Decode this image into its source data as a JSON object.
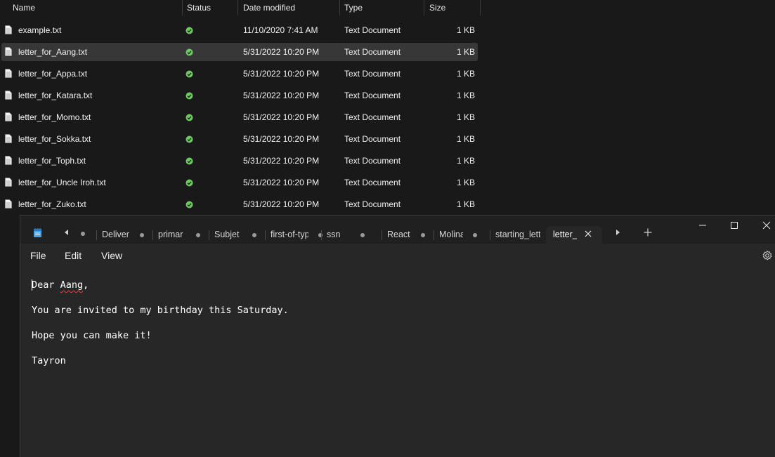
{
  "explorer": {
    "columns": {
      "name": "Name",
      "status": "Status",
      "date": "Date modified",
      "type": "Type",
      "size": "Size"
    },
    "files": [
      {
        "name": "example.txt",
        "date": "11/10/2020 7:41 AM",
        "type": "Text Document",
        "size": "1 KB",
        "selected": false
      },
      {
        "name": "letter_for_Aang.txt",
        "date": "5/31/2022 10:20 PM",
        "type": "Text Document",
        "size": "1 KB",
        "selected": true
      },
      {
        "name": "letter_for_Appa.txt",
        "date": "5/31/2022 10:20 PM",
        "type": "Text Document",
        "size": "1 KB",
        "selected": false
      },
      {
        "name": "letter_for_Katara.txt",
        "date": "5/31/2022 10:20 PM",
        "type": "Text Document",
        "size": "1 KB",
        "selected": false
      },
      {
        "name": "letter_for_Momo.txt",
        "date": "5/31/2022 10:20 PM",
        "type": "Text Document",
        "size": "1 KB",
        "selected": false
      },
      {
        "name": "letter_for_Sokka.txt",
        "date": "5/31/2022 10:20 PM",
        "type": "Text Document",
        "size": "1 KB",
        "selected": false
      },
      {
        "name": "letter_for_Toph.txt",
        "date": "5/31/2022 10:20 PM",
        "type": "Text Document",
        "size": "1 KB",
        "selected": false
      },
      {
        "name": "letter_for_Uncle Iroh.txt",
        "date": "5/31/2022 10:20 PM",
        "type": "Text Document",
        "size": "1 KB",
        "selected": false
      },
      {
        "name": "letter_for_Zuko.txt",
        "date": "5/31/2022 10:20 PM",
        "type": "Text Document",
        "size": "1 KB",
        "selected": false
      }
    ],
    "status_icon": "synced-check-icon",
    "status_color": "#6ccb5f"
  },
  "notepad": {
    "app_icon": "notepad-icon",
    "tabs": [
      {
        "label": "Deliver",
        "active": false
      },
      {
        "label": "primar",
        "active": false
      },
      {
        "label": "Subjet",
        "active": false
      },
      {
        "label": "first-of-type",
        "active": false
      },
      {
        "label": "ssn",
        "active": false
      },
      {
        "label": "React",
        "active": false
      },
      {
        "label": "Molina",
        "active": false
      },
      {
        "label": "starting_lette",
        "active": false
      },
      {
        "label": "letter_",
        "active": true
      }
    ],
    "menu": {
      "file": "File",
      "edit": "Edit",
      "view": "View"
    },
    "content": {
      "line1_word1": "Dear",
      "line1_word2": "Aang",
      "line1_punct": ",",
      "line2": "You are invited to my birthday this Saturday.",
      "line3": "Hope you can make it!",
      "line4": "Tayron"
    }
  }
}
